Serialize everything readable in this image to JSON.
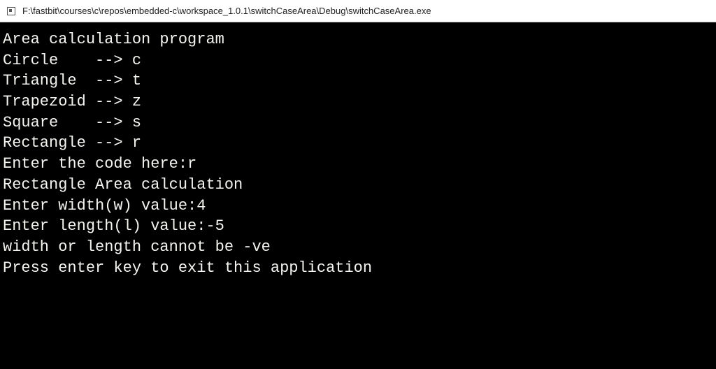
{
  "window": {
    "title": "F:\\fastbit\\courses\\c\\repos\\embedded-c\\workspace_1.0.1\\switchCaseArea\\Debug\\switchCaseArea.exe"
  },
  "console": {
    "lines": [
      "Area calculation program",
      "Circle    --> c",
      "Triangle  --> t",
      "Trapezoid --> z",
      "Square    --> s",
      "Rectangle --> r",
      "Enter the code here:r",
      "Rectangle Area calculation",
      "Enter width(w) value:4",
      "Enter length(l) value:-5",
      "width or length cannot be -ve",
      "Press enter key to exit this application"
    ]
  }
}
